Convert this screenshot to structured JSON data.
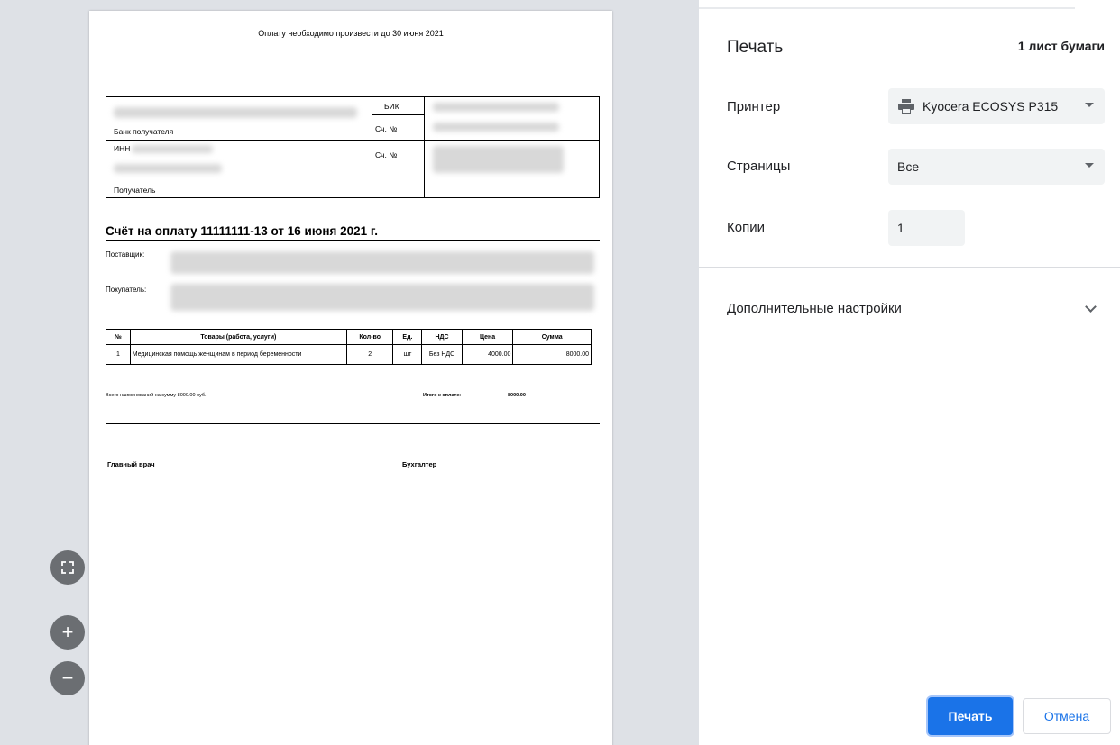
{
  "preview": {
    "deadline": "Оплату необходимо произвести до 30 июня 2021",
    "bank": {
      "bik_label": "БИК",
      "acc_label_1": "Сч. №",
      "acc_label_2": "Сч. №",
      "bank_label": "Банк получателя",
      "inn_label": "ИНН",
      "recipient_label": "Получатель"
    },
    "invoice_title": "Счёт на оплату 11111111-13 от 16 июня 2021 г.",
    "supplier_label": "Поставщик:",
    "buyer_label": "Покупатель:",
    "goods_table": {
      "headers": [
        "№",
        "Товары (работа, услуги)",
        "Кол-во",
        "Ед.",
        "НДС",
        "Цена",
        "Сумма"
      ],
      "rows": [
        [
          "1",
          "Медицинская помощь женщинам в период беременности",
          "2",
          "шт",
          "Без НДС",
          "4000.00",
          "8000.00"
        ]
      ]
    },
    "total_items_text": "Всего наименований на сумму 8000.00 руб.",
    "total_label": "Итого к оплате:",
    "total_value": "8000.00",
    "chief_doctor": "Главный врач",
    "accountant": "Бухгалтер"
  },
  "zoom": {
    "fit_icon": "fit-to-page-icon",
    "zoom_in_icon": "plus-icon",
    "zoom_out_icon": "minus-icon",
    "plus": "+",
    "minus": "−"
  },
  "panel": {
    "title": "Печать",
    "sheets": "1 лист бумаги",
    "printer_label": "Принтер",
    "printer_value": "Kyocera ECOSYS P315",
    "printer_icon": "printer-icon",
    "pages_label": "Страницы",
    "pages_value": "Все",
    "copies_label": "Копии",
    "copies_value": "1",
    "more_settings": "Дополнительные настройки",
    "print_button": "Печать",
    "cancel_button": "Отмена",
    "accent_color": "#1a73e8"
  }
}
